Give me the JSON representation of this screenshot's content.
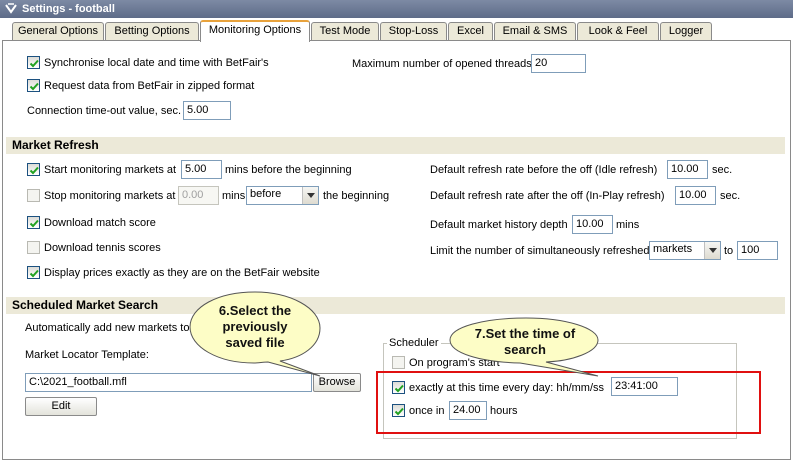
{
  "window": {
    "title": "Settings - football"
  },
  "tabs": [
    {
      "label": "General Options"
    },
    {
      "label": "Betting Options"
    },
    {
      "label": "Monitoring Options"
    },
    {
      "label": "Test Mode"
    },
    {
      "label": "Stop-Loss"
    },
    {
      "label": "Excel"
    },
    {
      "label": "Email & SMS"
    },
    {
      "label": "Look & Feel"
    },
    {
      "label": "Logger"
    }
  ],
  "active_tab": "Monitoring Options",
  "general": {
    "sync_label": "Synchronise local date and time with BetFair's",
    "sync_checked": true,
    "zip_label": "Request data from BetFair in zipped format",
    "zip_checked": true,
    "timeout_label": "Connection time-out value, sec.",
    "timeout_value": "5.00",
    "threads_label": "Maximum number of opened threads",
    "threads_value": "20"
  },
  "market_refresh": {
    "heading": "Market Refresh",
    "start_label": "Start monitoring markets at",
    "start_checked": true,
    "start_value": "5.00",
    "start_suffix": "mins before the beginning",
    "stop_label": "Stop monitoring markets at",
    "stop_checked": false,
    "stop_value": "0.00",
    "stop_mins": "mins",
    "stop_select": "before",
    "stop_suffix": "the beginning",
    "match_score_label": "Download match score",
    "match_score_checked": true,
    "tennis_label": "Download tennis scores",
    "tennis_checked": false,
    "display_prices_label": "Display prices exactly as they are on the BetFair website",
    "display_prices_checked": true,
    "idle_label": "Default refresh rate before the off (Idle refresh)",
    "idle_value": "10.00",
    "idle_unit": "sec.",
    "inplay_label": "Default refresh rate after the off (In-Play refresh)",
    "inplay_value": "10.00",
    "inplay_unit": "sec.",
    "history_label": "Default market history depth",
    "history_value": "10.00",
    "history_unit": "mins",
    "limit_label": "Limit the number of simultaneously refreshed",
    "limit_select": "markets",
    "limit_to": "to",
    "limit_value": "100"
  },
  "scheduled_search": {
    "heading": "Scheduled Market Search",
    "auto_add_label": "Automatically add new markets to",
    "template_label": "Market Locator Template:",
    "template_value": "C:\\2021_football.mfl",
    "browse_label": "Browse",
    "edit_label": "Edit",
    "scheduler_title": "Scheduler",
    "on_start_label": "On program's start",
    "on_start_checked": false,
    "exact_time_label": "exactly at this time every day: hh/mm/ss",
    "exact_time_checked": true,
    "exact_time_value": "23:41:00",
    "once_in_label": "once in",
    "once_in_checked": true,
    "once_in_value": "24.00",
    "once_in_unit": "hours"
  },
  "callouts": {
    "select_file": [
      "6.Select the",
      "previously",
      "saved file"
    ],
    "set_time": [
      "7.Set the time of",
      "search"
    ]
  },
  "colors": {
    "callout_fill": "#fdfdc6",
    "highlight_border": "#e01010",
    "active_tab_accent": "#e8a23c",
    "section_bg": "#ece9d8"
  }
}
